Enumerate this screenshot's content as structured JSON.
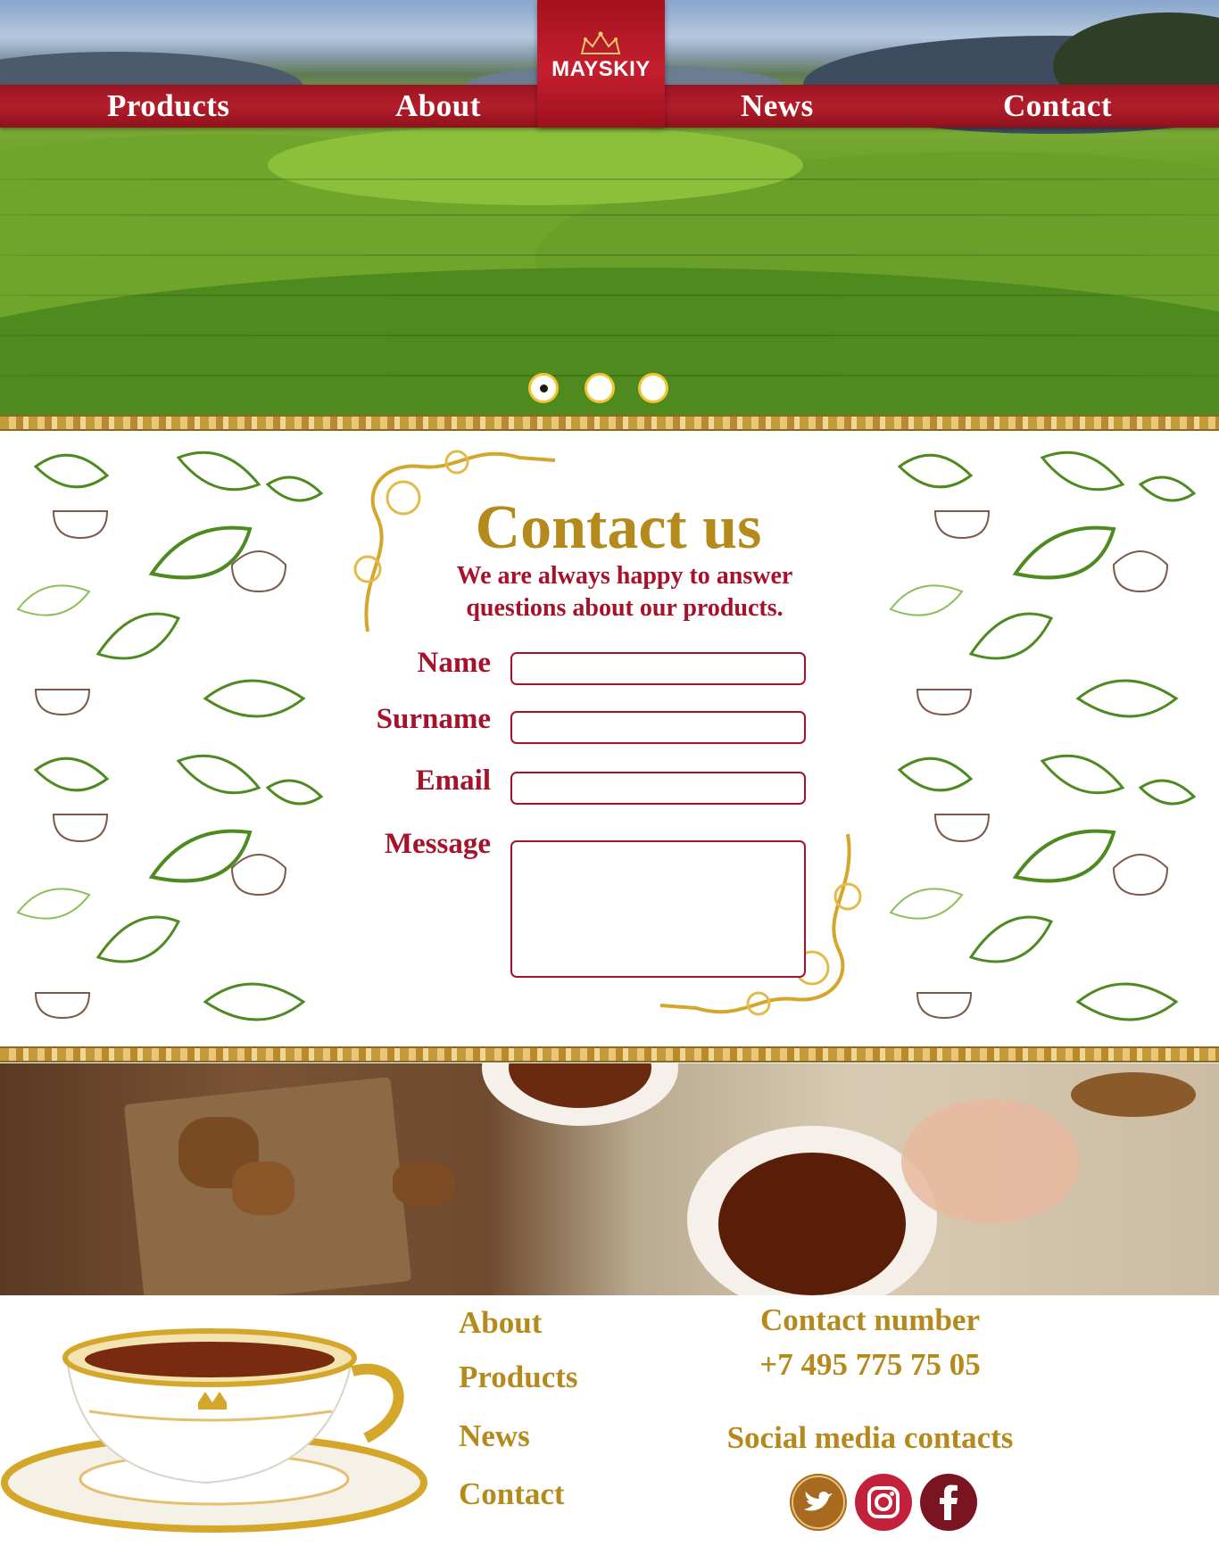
{
  "brand": {
    "logo_text": "MAYSKIY"
  },
  "nav": {
    "items": [
      {
        "label": "Products"
      },
      {
        "label": "About"
      },
      {
        "label": "News"
      },
      {
        "label": "Contact"
      }
    ]
  },
  "slider": {
    "total": 3,
    "active_index": 1
  },
  "contact_form": {
    "title": "Contact us",
    "subtitle_line1": "We are always happy to answer",
    "subtitle_line2": "questions about our products.",
    "fields": {
      "name": {
        "label": "Name",
        "value": ""
      },
      "surname": {
        "label": "Surname",
        "value": ""
      },
      "email": {
        "label": "Email",
        "value": ""
      },
      "message": {
        "label": "Message",
        "value": ""
      }
    }
  },
  "footer": {
    "links": [
      {
        "label": "About"
      },
      {
        "label": "Products"
      },
      {
        "label": "News"
      },
      {
        "label": "Contact"
      }
    ],
    "contact_heading": "Contact number",
    "phone": "+7 495 775 75 05",
    "social_heading": "Social media contacts",
    "social": [
      {
        "icon": "twitter-icon",
        "color": "#a86a1e"
      },
      {
        "icon": "instagram-icon",
        "color": "#c3203c"
      },
      {
        "icon": "facebook-icon",
        "color": "#7a1420"
      }
    ]
  },
  "colors": {
    "brand_red": "#a5122a",
    "nav_red": "#b31d2b",
    "gold": "#b58a1c",
    "slider_ring": "#f4c430"
  }
}
